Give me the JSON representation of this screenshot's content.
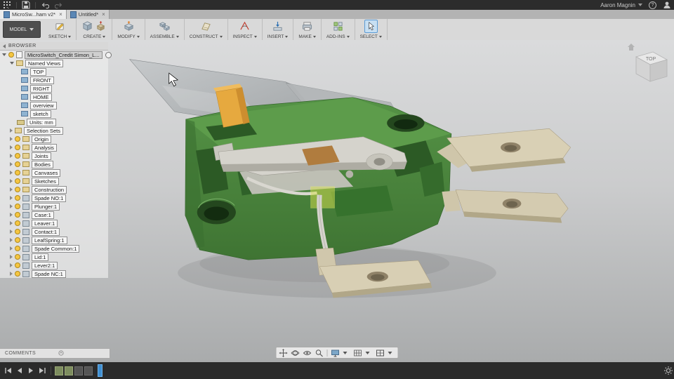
{
  "topbar": {
    "user_name": "Aaron Magnin",
    "help": "?"
  },
  "tabs": [
    {
      "title": "MicroSw...ham v2*",
      "close": "×"
    },
    {
      "title": "Untitled*",
      "close": "×"
    }
  ],
  "toolbar": {
    "workspace": "MODEL",
    "groups": [
      "SKETCH",
      "CREATE",
      "MODIFY",
      "ASSEMBLE",
      "CONSTRUCT",
      "INSPECT",
      "INSERT",
      "MAKE",
      "ADD-INS",
      "SELECT"
    ]
  },
  "browser": {
    "header": "BROWSER",
    "root": "MicroSwitch_Credit Simon_L...",
    "named_views": "Named Views",
    "views": [
      "TOP",
      "FRONT",
      "RIGHT",
      "HOME",
      "overview",
      "sketch"
    ],
    "units": "Units: mm",
    "folders": [
      "Selection Sets",
      "Origin",
      "Analysis",
      "Joints",
      "Bodies",
      "Canvases",
      "Sketches",
      "Construction"
    ],
    "components": [
      "Spade NO:1",
      "Plunger:1",
      "Case:1",
      "Leaver:1",
      "Contact:1",
      "LeafSpring:1",
      "Spade Common:1",
      "Lid:1",
      "Lever2:1",
      "Spade NC:1"
    ]
  },
  "viewcube": {
    "top": "TOP"
  },
  "comments": {
    "label": "COMMENTS"
  },
  "colors": {
    "accent_blue": "#3f8fd2",
    "case_green": "#4e8c3e",
    "metal_tan": "#d8cfb4",
    "plunger_orange": "#e6a93f"
  }
}
